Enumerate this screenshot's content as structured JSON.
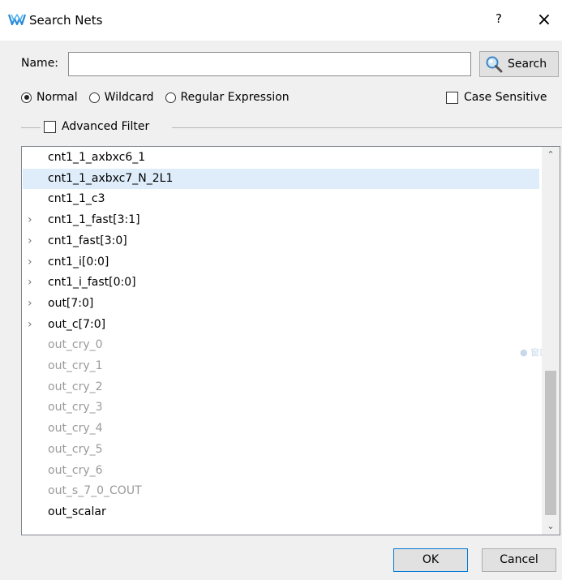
{
  "window": {
    "title": "Search Nets",
    "help_label": "?",
    "close_label": "×"
  },
  "search": {
    "name_label": "Name:",
    "name_value": "",
    "search_button_label": "Search"
  },
  "modes": {
    "options": [
      "Normal",
      "Wildcard",
      "Regular Expression"
    ],
    "selected": "Normal",
    "case_sensitive_label": "Case Sensitive",
    "case_sensitive_checked": false
  },
  "advanced_filter": {
    "label": "Advanced Filter",
    "checked": false
  },
  "nets": {
    "items": [
      {
        "label": "cnt1_1_axbxc6_1",
        "expandable": false,
        "grey": false
      },
      {
        "label": "cnt1_1_axbxc7_N_2L1",
        "expandable": false,
        "grey": false,
        "selected": true
      },
      {
        "label": "cnt1_1_c3",
        "expandable": false,
        "grey": false
      },
      {
        "label": "cnt1_1_fast[3:1]",
        "expandable": true,
        "grey": false
      },
      {
        "label": "cnt1_fast[3:0]",
        "expandable": true,
        "grey": false
      },
      {
        "label": "cnt1_i[0:0]",
        "expandable": true,
        "grey": false
      },
      {
        "label": "cnt1_i_fast[0:0]",
        "expandable": true,
        "grey": false
      },
      {
        "label": "out[7:0]",
        "expandable": true,
        "grey": false
      },
      {
        "label": "out_c[7:0]",
        "expandable": true,
        "grey": false
      },
      {
        "label": "out_cry_0",
        "expandable": false,
        "grey": true
      },
      {
        "label": "out_cry_1",
        "expandable": false,
        "grey": true
      },
      {
        "label": "out_cry_2",
        "expandable": false,
        "grey": true
      },
      {
        "label": "out_cry_3",
        "expandable": false,
        "grey": true
      },
      {
        "label": "out_cry_4",
        "expandable": false,
        "grey": true
      },
      {
        "label": "out_cry_5",
        "expandable": false,
        "grey": true
      },
      {
        "label": "out_cry_6",
        "expandable": false,
        "grey": true
      },
      {
        "label": "out_s_7_0_COUT",
        "expandable": false,
        "grey": true
      },
      {
        "label": "out_scalar",
        "expandable": false,
        "grey": false
      }
    ],
    "ghost_text": "●  窗口截"
  },
  "footer": {
    "ok_label": "OK",
    "cancel_label": "Cancel"
  },
  "colors": {
    "selection": "#dfedfb",
    "default_border": "#0078d7",
    "grey_text": "#9a9a9a"
  }
}
